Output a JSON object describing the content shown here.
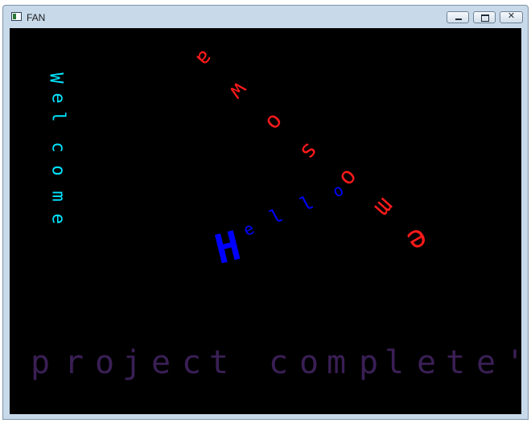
{
  "window": {
    "title": "FAN",
    "minimize_glyph": "—",
    "maximize_glyph": "□",
    "close_glyph": "✕"
  },
  "colors": {
    "welcome": "#00e5ff",
    "awosome": "#ff1a1a",
    "hello": "#0000ff",
    "project": "#3a1f55",
    "canvas_bg": "#000000"
  },
  "canvas_text": {
    "welcome": [
      "W",
      "e",
      "l",
      "c",
      "o",
      "m",
      "e"
    ],
    "awosome": [
      "a",
      "w",
      "o",
      "s",
      "o",
      "m",
      "e"
    ],
    "hello": [
      "H",
      "e",
      "l",
      "l",
      "o"
    ],
    "project": [
      "p",
      "r",
      "o",
      "j",
      "e",
      "c",
      "t",
      " ",
      "c",
      "o",
      "m",
      "p",
      "l",
      "e",
      "t",
      "e",
      "'"
    ]
  }
}
